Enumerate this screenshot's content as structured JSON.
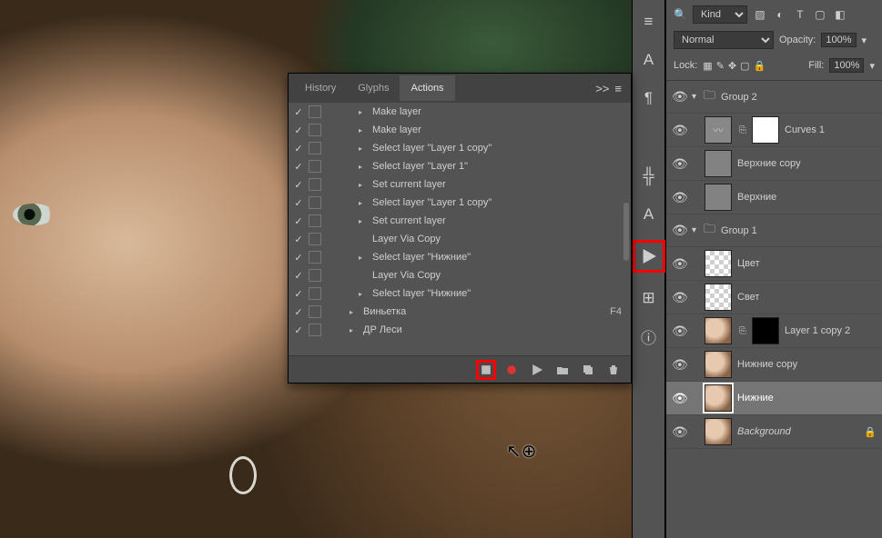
{
  "actions_panel": {
    "tabs": {
      "history": "History",
      "glyphs": "Glyphs",
      "actions": "Actions"
    },
    "menu_glyph": ">>",
    "rows": [
      {
        "checked": true,
        "caret": true,
        "indent": 1,
        "label": "Make layer"
      },
      {
        "checked": true,
        "caret": true,
        "indent": 1,
        "label": "Make layer"
      },
      {
        "checked": true,
        "caret": true,
        "indent": 1,
        "label": "Select layer \"Layer 1 copy\""
      },
      {
        "checked": true,
        "caret": true,
        "indent": 1,
        "label": "Select layer \"Layer 1\""
      },
      {
        "checked": true,
        "caret": true,
        "indent": 1,
        "label": "Set current layer"
      },
      {
        "checked": true,
        "caret": true,
        "indent": 1,
        "label": "Select layer \"Layer 1 copy\""
      },
      {
        "checked": true,
        "caret": true,
        "indent": 1,
        "label": "Set current layer"
      },
      {
        "checked": true,
        "caret": false,
        "indent": 1,
        "label": "Layer Via Copy"
      },
      {
        "checked": true,
        "caret": true,
        "indent": 1,
        "label": "Select layer \"Нижние\""
      },
      {
        "checked": true,
        "caret": false,
        "indent": 1,
        "label": "Layer Via Copy"
      },
      {
        "checked": true,
        "caret": true,
        "indent": 1,
        "label": "Select layer \"Нижние\""
      },
      {
        "checked": true,
        "caret": true,
        "indent": 0,
        "label": "Виньетка",
        "shortcut": "F4"
      },
      {
        "checked": true,
        "caret": true,
        "indent": 0,
        "label": "ДР Леси"
      }
    ]
  },
  "layers_panel": {
    "filter_label": "Kind",
    "blend_mode": "Normal",
    "opacity_label": "Opacity:",
    "opacity_value": "100%",
    "lock_label": "Lock:",
    "fill_label": "Fill:",
    "fill_value": "100%",
    "layers": [
      {
        "type": "group",
        "name": "Group 2",
        "open": true
      },
      {
        "type": "adj",
        "name": "Curves 1",
        "linked": true,
        "mask": "white"
      },
      {
        "type": "layer",
        "name": "Верхние copy",
        "thumb": "gray"
      },
      {
        "type": "layer",
        "name": "Верхние",
        "thumb": "gray"
      },
      {
        "type": "group",
        "name": "Group 1",
        "open": true
      },
      {
        "type": "layer",
        "name": "Цвет",
        "thumb": "checker"
      },
      {
        "type": "layer",
        "name": "Свет",
        "thumb": "checker"
      },
      {
        "type": "layer",
        "name": "Layer 1 copy 2",
        "thumb": "photo",
        "mask": "black",
        "linked": true
      },
      {
        "type": "layer",
        "name": "Нижние copy",
        "thumb": "photo"
      },
      {
        "type": "layer",
        "name": "Нижние",
        "thumb": "photo",
        "selected": true
      },
      {
        "type": "layer",
        "name": "Background",
        "thumb": "photo",
        "italic": true,
        "locked": true
      }
    ]
  },
  "toolstrip": {
    "icons": [
      "≡",
      "A",
      "¶",
      "╬",
      "A",
      "▶",
      "⊞",
      "ⓘ"
    ]
  },
  "highlight_color": "#ff0000"
}
